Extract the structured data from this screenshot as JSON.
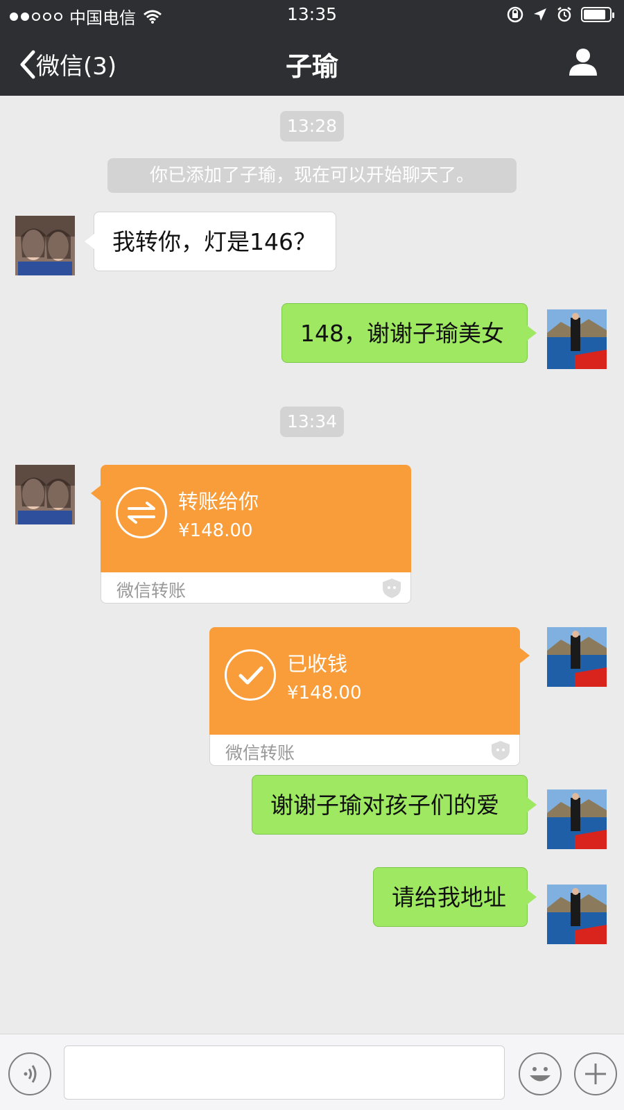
{
  "status_bar": {
    "carrier": "中国电信",
    "time": "13:35",
    "signal_bars_filled": 2,
    "signal_bars_total": 5,
    "battery_level": 0.85
  },
  "nav": {
    "back_label": "微信(3)",
    "title": "子瑜"
  },
  "chat": {
    "timestamp_1": "13:28",
    "system_message": "你已添加了子瑜，现在可以开始聊天了。",
    "msg_1": "我转你，灯是146？",
    "msg_2": "148，谢谢子瑜美女",
    "timestamp_2": "13:34",
    "transfer_in": {
      "title": "转账给你",
      "amount": "¥148.00",
      "label": "微信转账"
    },
    "transfer_out": {
      "title": "已收钱",
      "amount": "¥148.00",
      "label": "微信转账"
    },
    "msg_3": "谢谢子瑜对孩子们的爱",
    "msg_4": "请给我地址"
  },
  "input_bar": {
    "value": ""
  },
  "colors": {
    "nav_bg": "#2e2f33",
    "chat_bg": "#ebebeb",
    "out_bubble": "#9ee862",
    "transfer": "#f89d3a"
  },
  "icons": [
    "back-chevron-icon",
    "wifi-icon",
    "lock-rotation-icon",
    "location-arrow-icon",
    "alarm-icon",
    "battery-icon",
    "contact-profile-icon",
    "transfer-arrows-icon",
    "checkmark-icon",
    "shield-icon",
    "voice-icon",
    "emoji-icon",
    "plus-icon"
  ]
}
